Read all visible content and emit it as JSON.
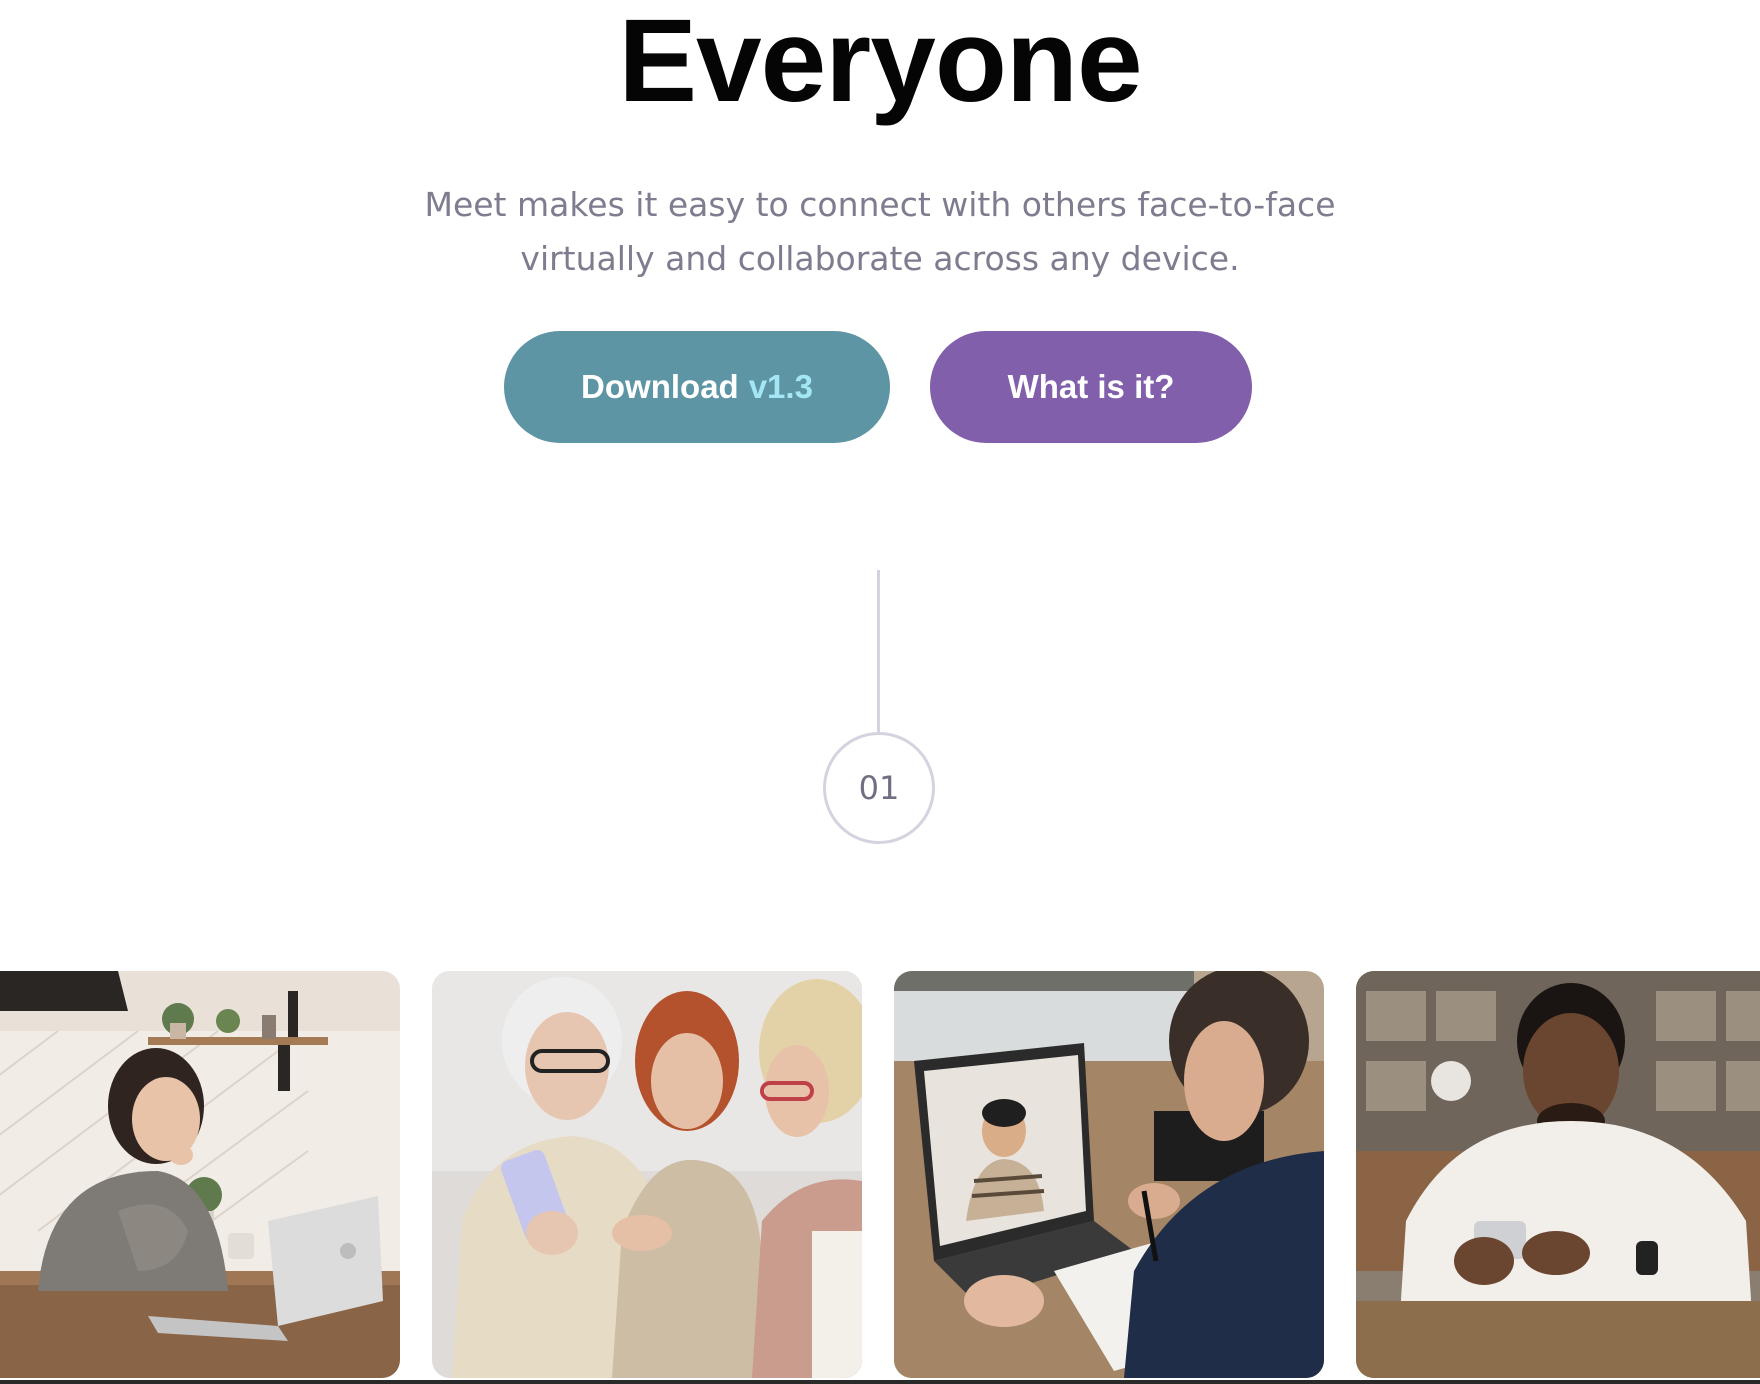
{
  "hero": {
    "title": "Everyone",
    "subtitle_line1": "Meet makes it easy to connect with others face-to-face",
    "subtitle_line2": "virtually and collaborate across any device."
  },
  "buttons": {
    "download_label": "Download",
    "download_version": "v1.3",
    "what_label": "What is it?"
  },
  "step": {
    "number": "01"
  },
  "gallery": [
    {
      "scene": "woman-laughing-at-laptop-in-kitchen"
    },
    {
      "scene": "three-women-looking-at-phone"
    },
    {
      "scene": "man-on-video-call-with-laptop"
    },
    {
      "scene": "man-smiling-at-smartphone"
    }
  ],
  "colors": {
    "download_button": "#5e95a4",
    "download_version": "#a4e6f4",
    "what_button": "#825fab",
    "subtitle_text": "#7e7c8e",
    "step_border": "#d4d3e0"
  }
}
